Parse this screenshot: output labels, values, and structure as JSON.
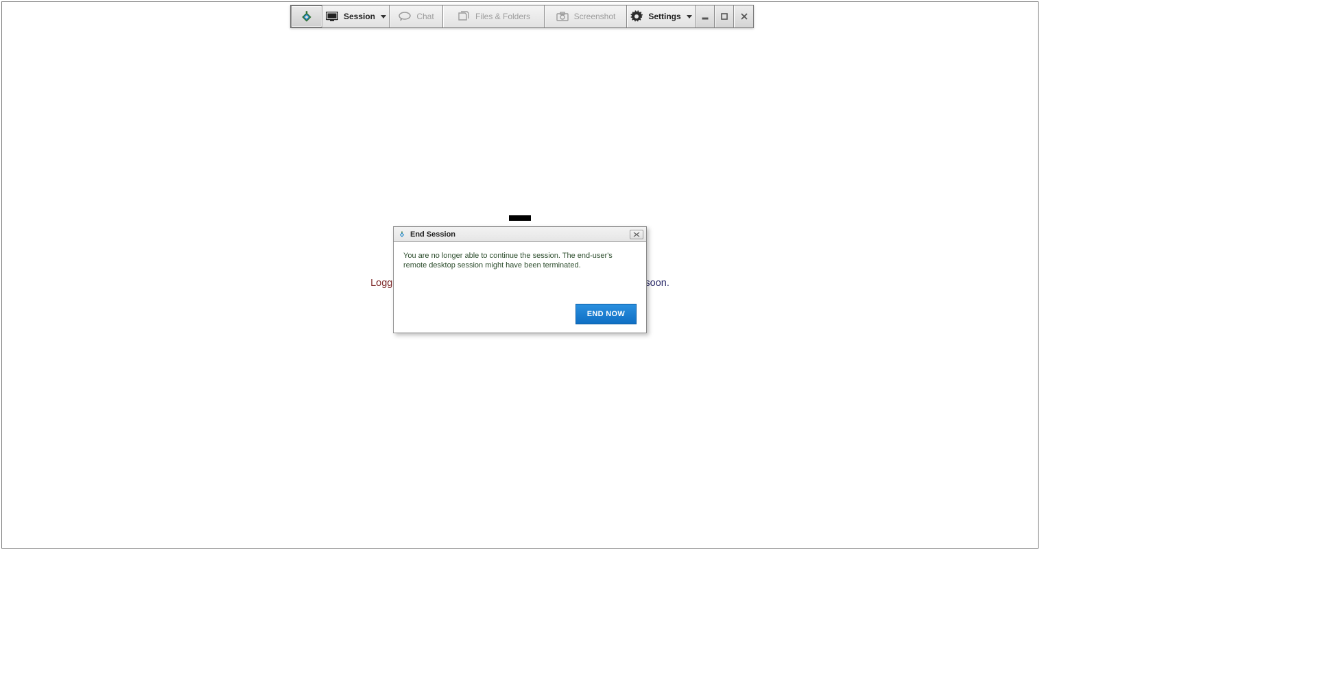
{
  "toolbar": {
    "session_label": "Session",
    "chat_label": "Chat",
    "files_label": "Files & Folders",
    "screenshot_label": "Screenshot",
    "settings_label": "Settings"
  },
  "background": {
    "status_left": "Logg",
    "status_right": "soon."
  },
  "dialog": {
    "title": "End Session",
    "message": "You are no longer able to continue the session. The end-user's remote desktop session might have been terminated.",
    "end_now_label": "END NOW"
  }
}
